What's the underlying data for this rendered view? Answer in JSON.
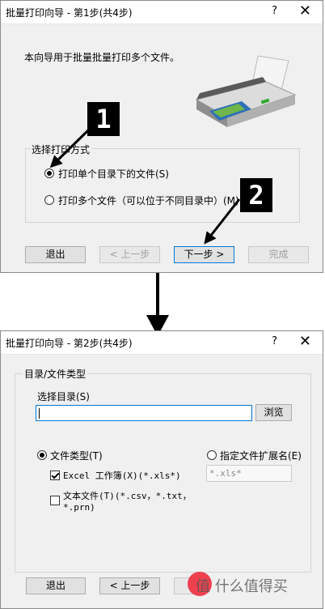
{
  "dialog1": {
    "title": "批量打印向导 - 第1步(共4步)",
    "help": "?",
    "close": "✕",
    "intro": "本向导用于批量批量打印多个文件。",
    "group_label": "选择打印方式",
    "option_single": "打印单个目录下的文件(S)",
    "option_multi": "打印多个文件（可以位于不同目录中）(M)",
    "badge1": "1",
    "badge2": "2",
    "buttons": {
      "exit": "退出",
      "prev": "< 上一步",
      "next": "下一步 >",
      "finish": "完成"
    }
  },
  "dialog2": {
    "title": "批量打印向导 - 第2步(共4步)",
    "help": "?",
    "close": "✕",
    "group_label": "目录/文件类型",
    "select_dir_label": "选择目录(S)",
    "dir_value": "",
    "browse": "浏览",
    "file_type_label": "文件类型(T)",
    "ext_label": "指定文件扩展名(E)",
    "ext_value": "*.xls*",
    "excel_label": "Excel 工作簿(X)(*.xls*)",
    "text_label": "文本文件(T)(*.csv，*.txt，",
    "text_label2": "*.prn)",
    "buttons": {
      "exit": "退出",
      "prev": "< 上一步"
    }
  },
  "watermark": "值 什么值得买",
  "colors": {
    "focus_blue": "#0078d7",
    "dialog_bg": "#f0f0f0"
  }
}
